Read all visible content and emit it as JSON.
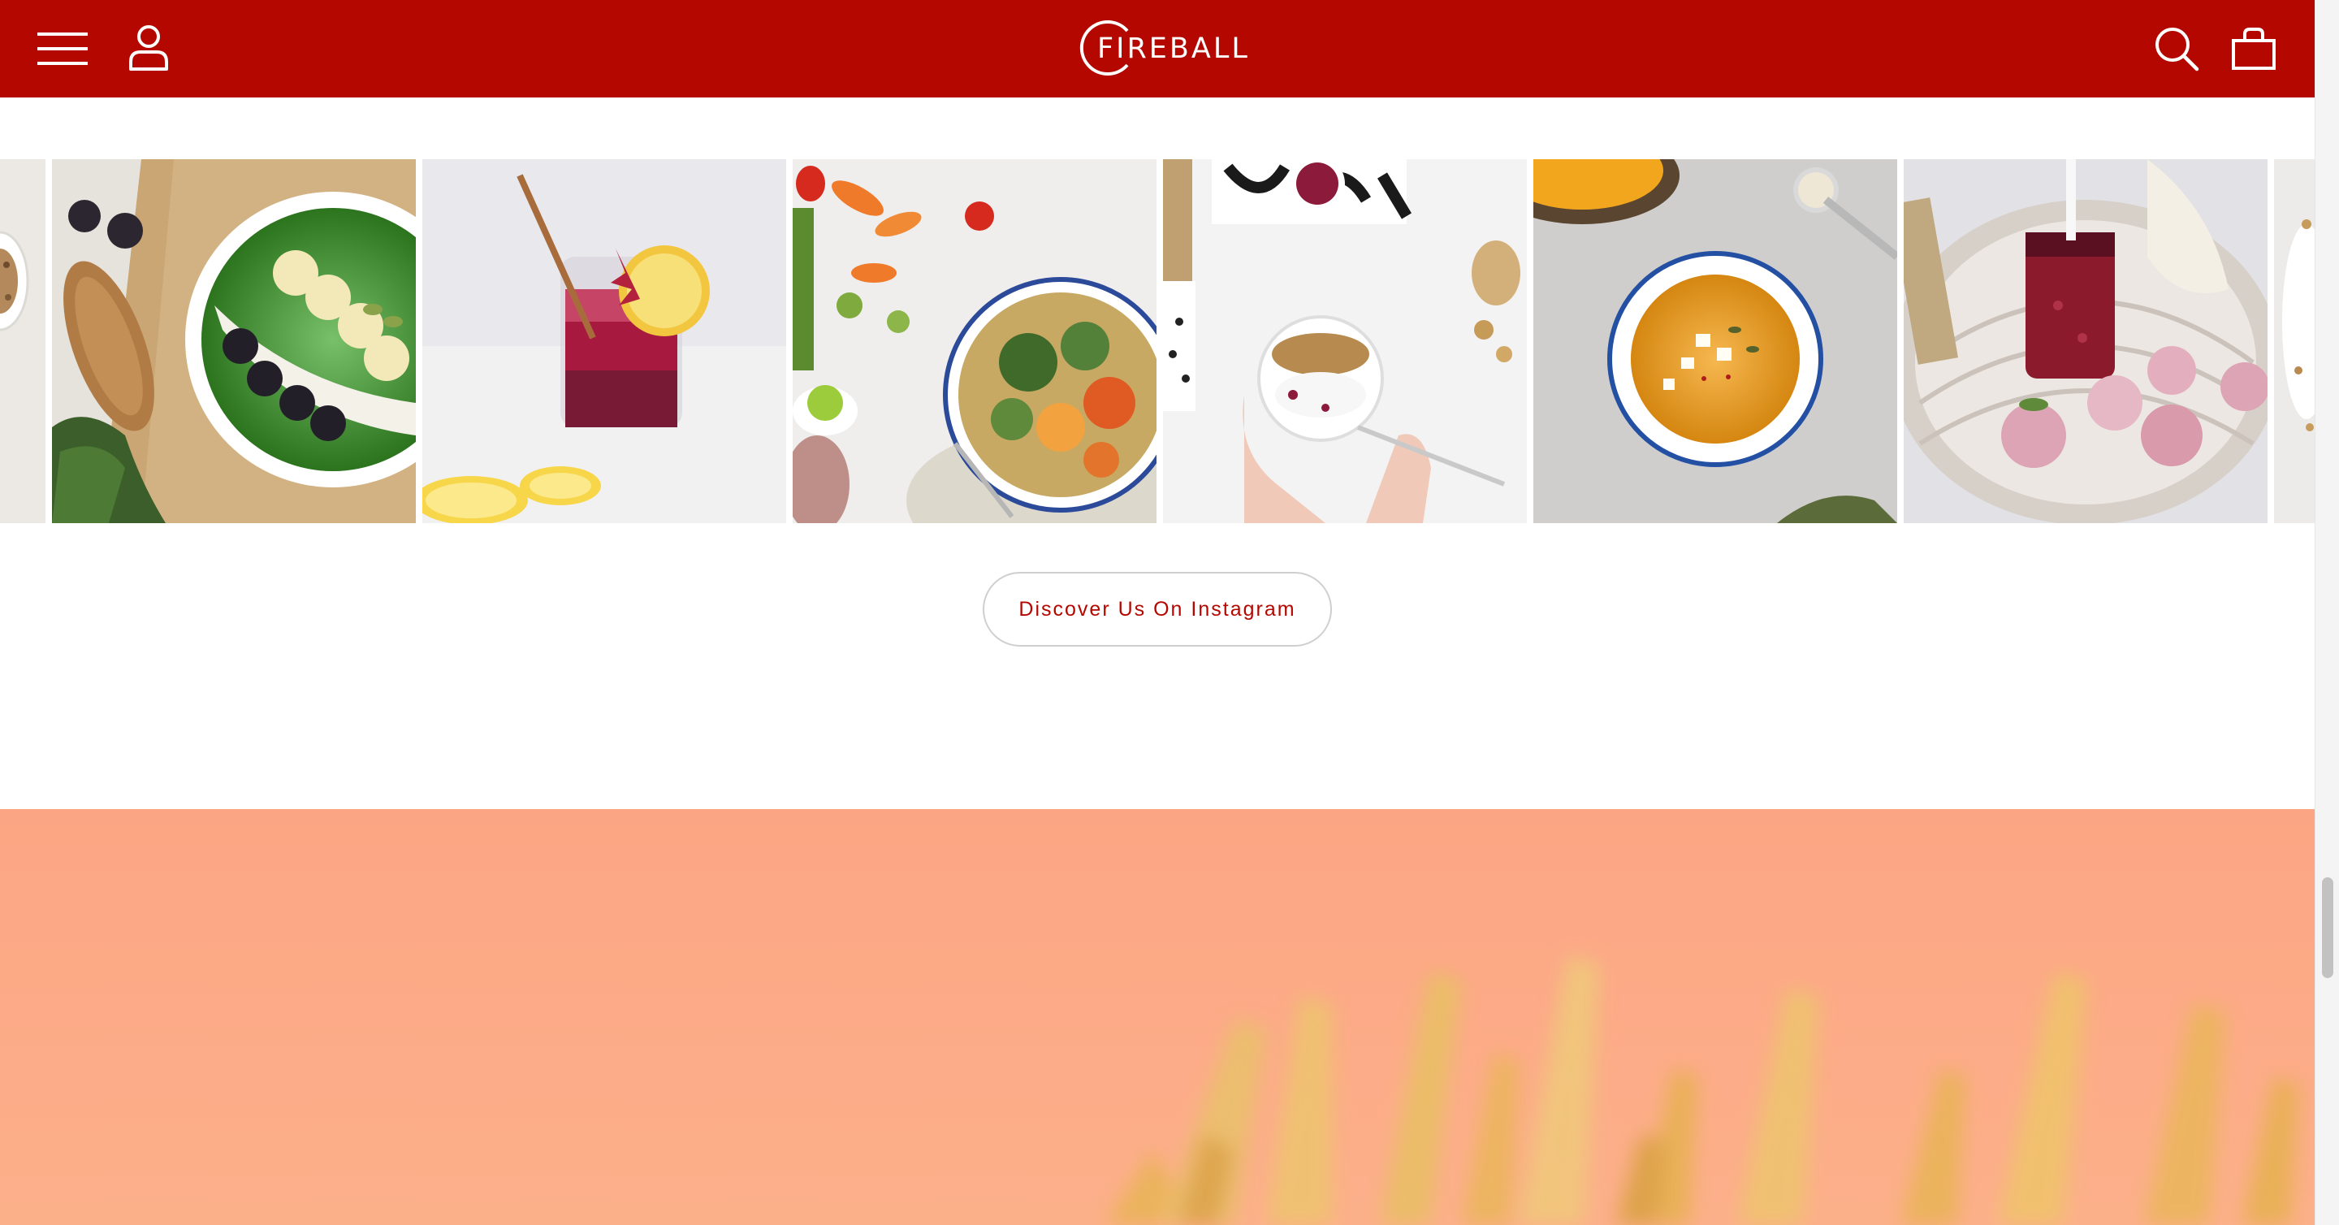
{
  "header": {
    "brand": "FIREBALL",
    "background": "#b30700",
    "icons": [
      "menu-icon",
      "user-icon",
      "search-icon",
      "shopping-bag-icon"
    ]
  },
  "instagram": {
    "tiles": [
      {
        "name": "granola-bowl-partial"
      },
      {
        "name": "green-smoothie-bowl"
      },
      {
        "name": "berry-drink-jar"
      },
      {
        "name": "roasted-vegetable-bowl"
      },
      {
        "name": "yogurt-granola-bowl"
      },
      {
        "name": "pumpkin-soup"
      },
      {
        "name": "berry-jam-basket"
      },
      {
        "name": "granola-partial"
      }
    ],
    "cta_label": "Discover Us On Instagram"
  },
  "colors": {
    "brand_red": "#b30700",
    "hero_peach": "#fda885",
    "cta_text": "#b30700"
  }
}
